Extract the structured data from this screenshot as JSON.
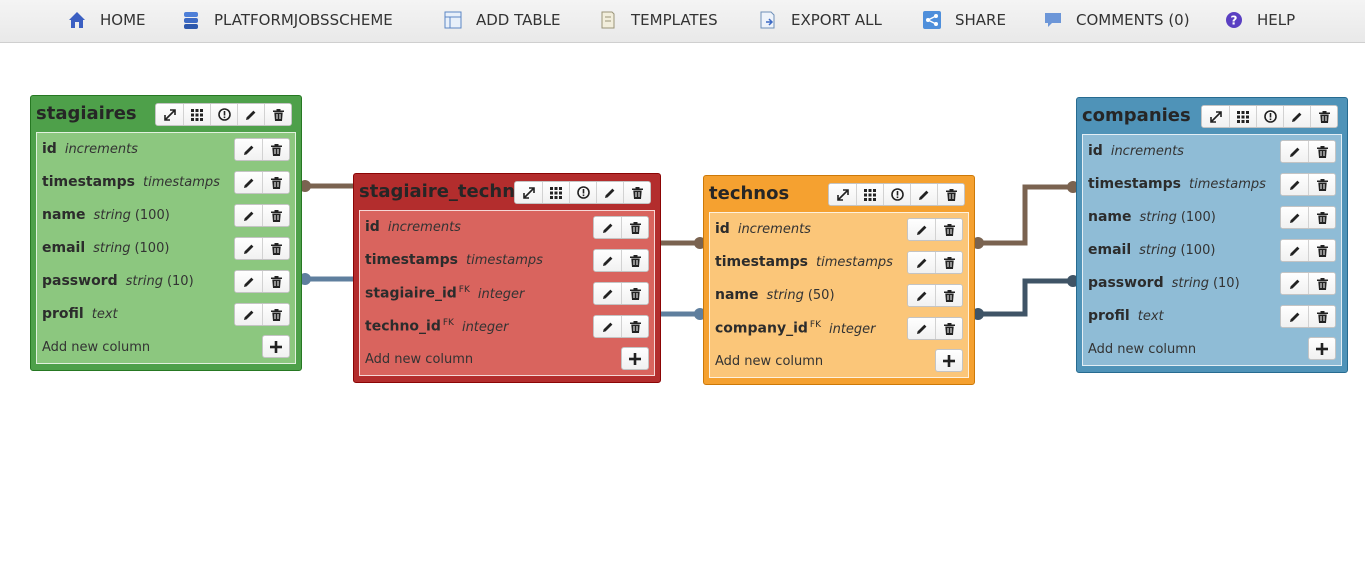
{
  "nav": [
    {
      "label": "HOME",
      "icon": "home-icon"
    },
    {
      "label": "PLATFORMJOBSSCHEME",
      "icon": "database-icon"
    },
    {
      "label": "ADD TABLE",
      "icon": "add-table-icon"
    },
    {
      "label": "TEMPLATES",
      "icon": "templates-icon"
    },
    {
      "label": "EXPORT ALL",
      "icon": "export-icon"
    },
    {
      "label": "SHARE",
      "icon": "share-icon"
    },
    {
      "label": "COMMENTS (0)",
      "icon": "comment-icon"
    },
    {
      "label": "HELP",
      "icon": "help-icon"
    }
  ],
  "tables": {
    "stagiaires": {
      "title": "stagiaires",
      "color": "#4ea04a",
      "body_color": "#8cc77f",
      "columns": [
        {
          "name": "id",
          "type": "increments",
          "size": ""
        },
        {
          "name": "timestamps",
          "type": "timestamps",
          "size": ""
        },
        {
          "name": "name",
          "type": "string",
          "size": "(100)"
        },
        {
          "name": "email",
          "type": "string",
          "size": "(100)"
        },
        {
          "name": "password",
          "type": "string",
          "size": "(10)"
        },
        {
          "name": "profil",
          "type": "text",
          "size": ""
        }
      ],
      "add_label": "Add new column"
    },
    "stagiaire_techno": {
      "title": "stagiaire_techno",
      "color": "#b32d2d",
      "body_color": "#d9645e",
      "columns": [
        {
          "name": "id",
          "type": "increments",
          "size": "",
          "fk": ""
        },
        {
          "name": "timestamps",
          "type": "timestamps",
          "size": "",
          "fk": ""
        },
        {
          "name": "stagiaire_id",
          "type": "integer",
          "size": "",
          "fk": "FK"
        },
        {
          "name": "techno_id",
          "type": "integer",
          "size": "",
          "fk": "FK"
        }
      ],
      "add_label": "Add new column"
    },
    "technos": {
      "title": "technos",
      "color": "#f5a130",
      "body_color": "#fbc679",
      "columns": [
        {
          "name": "id",
          "type": "increments",
          "size": "",
          "fk": ""
        },
        {
          "name": "timestamps",
          "type": "timestamps",
          "size": "",
          "fk": ""
        },
        {
          "name": "name",
          "type": "string",
          "size": "(50)",
          "fk": ""
        },
        {
          "name": "company_id",
          "type": "integer",
          "size": "",
          "fk": "FK"
        }
      ],
      "add_label": "Add new column"
    },
    "companies": {
      "title": "companies",
      "color": "#4f93b8",
      "body_color": "#8fbcd6",
      "columns": [
        {
          "name": "id",
          "type": "increments",
          "size": ""
        },
        {
          "name": "timestamps",
          "type": "timestamps",
          "size": ""
        },
        {
          "name": "name",
          "type": "string",
          "size": "(100)"
        },
        {
          "name": "email",
          "type": "string",
          "size": "(100)"
        },
        {
          "name": "password",
          "type": "string",
          "size": "(10)"
        },
        {
          "name": "profil",
          "type": "text",
          "size": ""
        }
      ],
      "add_label": "Add new column"
    }
  },
  "relation_colors": {
    "brown": "#7a6350",
    "steel": "#5f7f9e",
    "dark": "#3f5466"
  }
}
